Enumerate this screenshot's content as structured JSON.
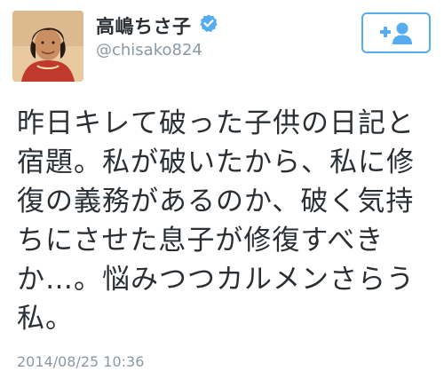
{
  "tweet": {
    "author": {
      "display_name": "高嶋ちさ子",
      "handle": "@chisako824",
      "verified": true,
      "avatar_icon": "profile-photo"
    },
    "follow_button": {
      "icon": "add-user-icon"
    },
    "text_lines": [
      "昨日キレて破った子供の日記と",
      "宿題。私が破いたから、私に修",
      "復の義務があるのか、破く気持",
      "ちにさせた息子が修復すべき",
      "か…。悩みつつカルメンさらう",
      "私。"
    ],
    "timestamp": "2014/08/25 10:36"
  },
  "colors": {
    "accent": "#55acee",
    "verified_badge": "#55acee",
    "text_primary": "#292f33",
    "text_secondary": "#8899a6"
  }
}
